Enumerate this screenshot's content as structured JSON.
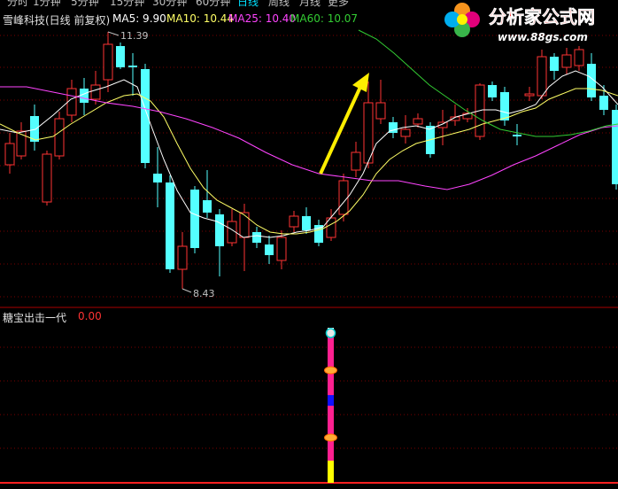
{
  "tabs": [
    "分时",
    "1分钟",
    "5分钟",
    "15分钟",
    "30分钟",
    "60分钟",
    "日线",
    "周线",
    "月线",
    "更多"
  ],
  "active_tab": "日线",
  "stock": {
    "title": "雪峰科技(日线 前复权)",
    "ma": [
      {
        "label": "MA5: 9.90",
        "color": "#ffffff"
      },
      {
        "label": "MA10: 10.44",
        "color": "#ffff66"
      },
      {
        "label": "MA25: 10.40",
        "color": "#ff44ff"
      },
      {
        "label": "MA60: 10.07",
        "color": "#33cc33"
      }
    ],
    "high_label": "11.39",
    "low_label": "8.43"
  },
  "indicator": {
    "title": "糖宝出击一代",
    "value": "0.00",
    "value_color": "#ff3333"
  },
  "logo": {
    "name": "分析家公式网",
    "url": "www.88gs.com"
  },
  "colors": {
    "up": "#ff3333",
    "down": "#54ffff",
    "grid": "#7a0000",
    "arrow": "#ffee00"
  }
}
